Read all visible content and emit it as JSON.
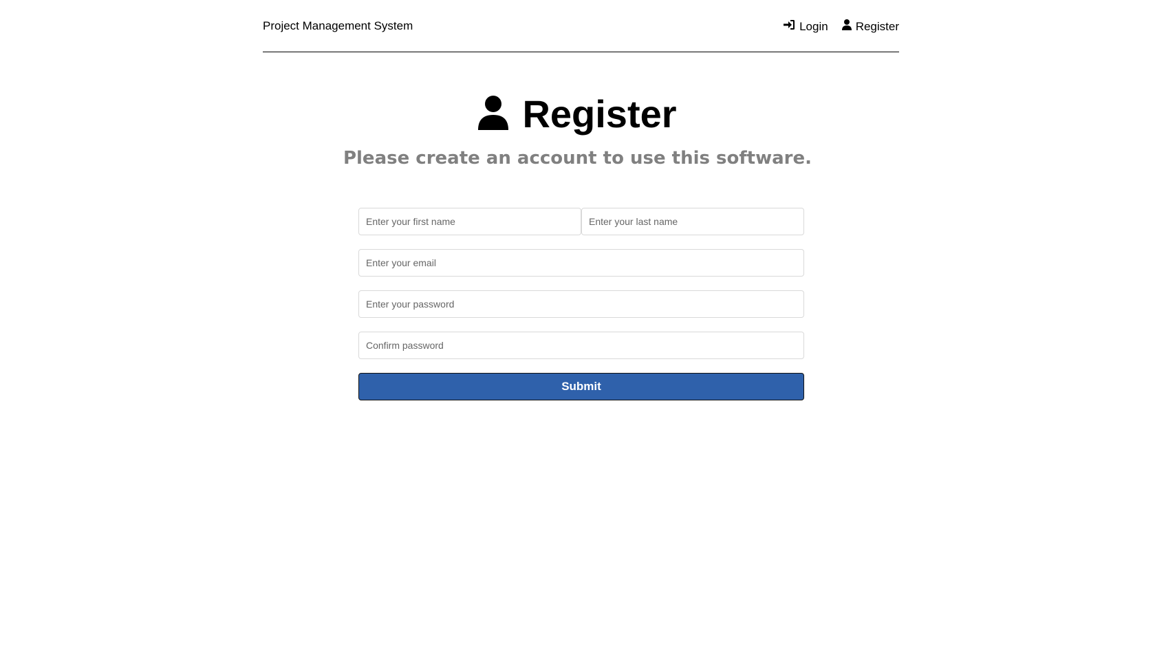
{
  "header": {
    "brand": "Project Management System",
    "nav": {
      "login_label": "Login",
      "login_icon": "sign-in-icon",
      "register_label": "Register",
      "register_icon": "user-icon"
    }
  },
  "page": {
    "title": "Register",
    "title_icon": "user-icon",
    "subtitle": "Please create an account to use this software."
  },
  "form": {
    "first_name": {
      "value": "",
      "placeholder": "Enter your first name"
    },
    "last_name": {
      "value": "",
      "placeholder": "Enter your last name"
    },
    "email": {
      "value": "",
      "placeholder": "Enter your email"
    },
    "password": {
      "value": "",
      "placeholder": "Enter your password"
    },
    "confirm_password": {
      "value": "",
      "placeholder": "Confirm password"
    },
    "submit_label": "Submit"
  },
  "colors": {
    "accent": "#2f61ab",
    "subtitle": "#808080",
    "text": "#000000"
  }
}
